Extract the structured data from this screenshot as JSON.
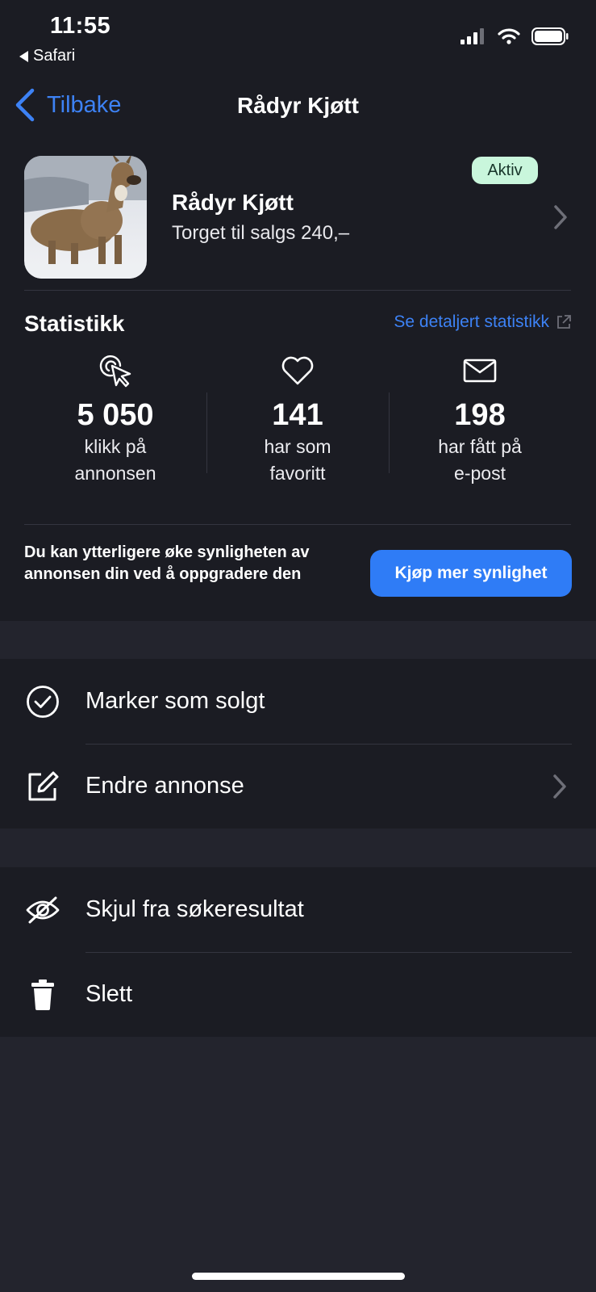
{
  "status_bar": {
    "time": "11:55",
    "back_app": "Safari"
  },
  "nav": {
    "back_label": "Tilbake",
    "title": "Rådyr Kjøtt"
  },
  "ad": {
    "status_badge": "Aktiv",
    "title": "Rådyr Kjøtt",
    "subtitle": "Torget til salgs 240,–"
  },
  "stats": {
    "title": "Statistikk",
    "details_link": "Se detaljert statistikk",
    "items": [
      {
        "icon": "click-cursor-icon",
        "value": "5 050",
        "line1": "klikk på",
        "line2": "annonsen"
      },
      {
        "icon": "heart-icon",
        "value": "141",
        "line1": "har som",
        "line2": "favoritt"
      },
      {
        "icon": "mail-icon",
        "value": "198",
        "line1": "har fått på",
        "line2": "e-post"
      }
    ]
  },
  "promo": {
    "text": "Du kan ytterligere øke synligheten av annonsen din ved å oppgradere den",
    "button": "Kjøp mer synlighet"
  },
  "actions": {
    "mark_sold": "Marker som solgt",
    "edit_ad": "Endre annonse",
    "hide": "Skjul fra søkeresultat",
    "delete": "Slett"
  },
  "colors": {
    "background": "#23242d",
    "surface": "#1b1c23",
    "accent": "#3d82f5",
    "button": "#2f7cf6",
    "badge_bg": "#c9f6dc"
  }
}
